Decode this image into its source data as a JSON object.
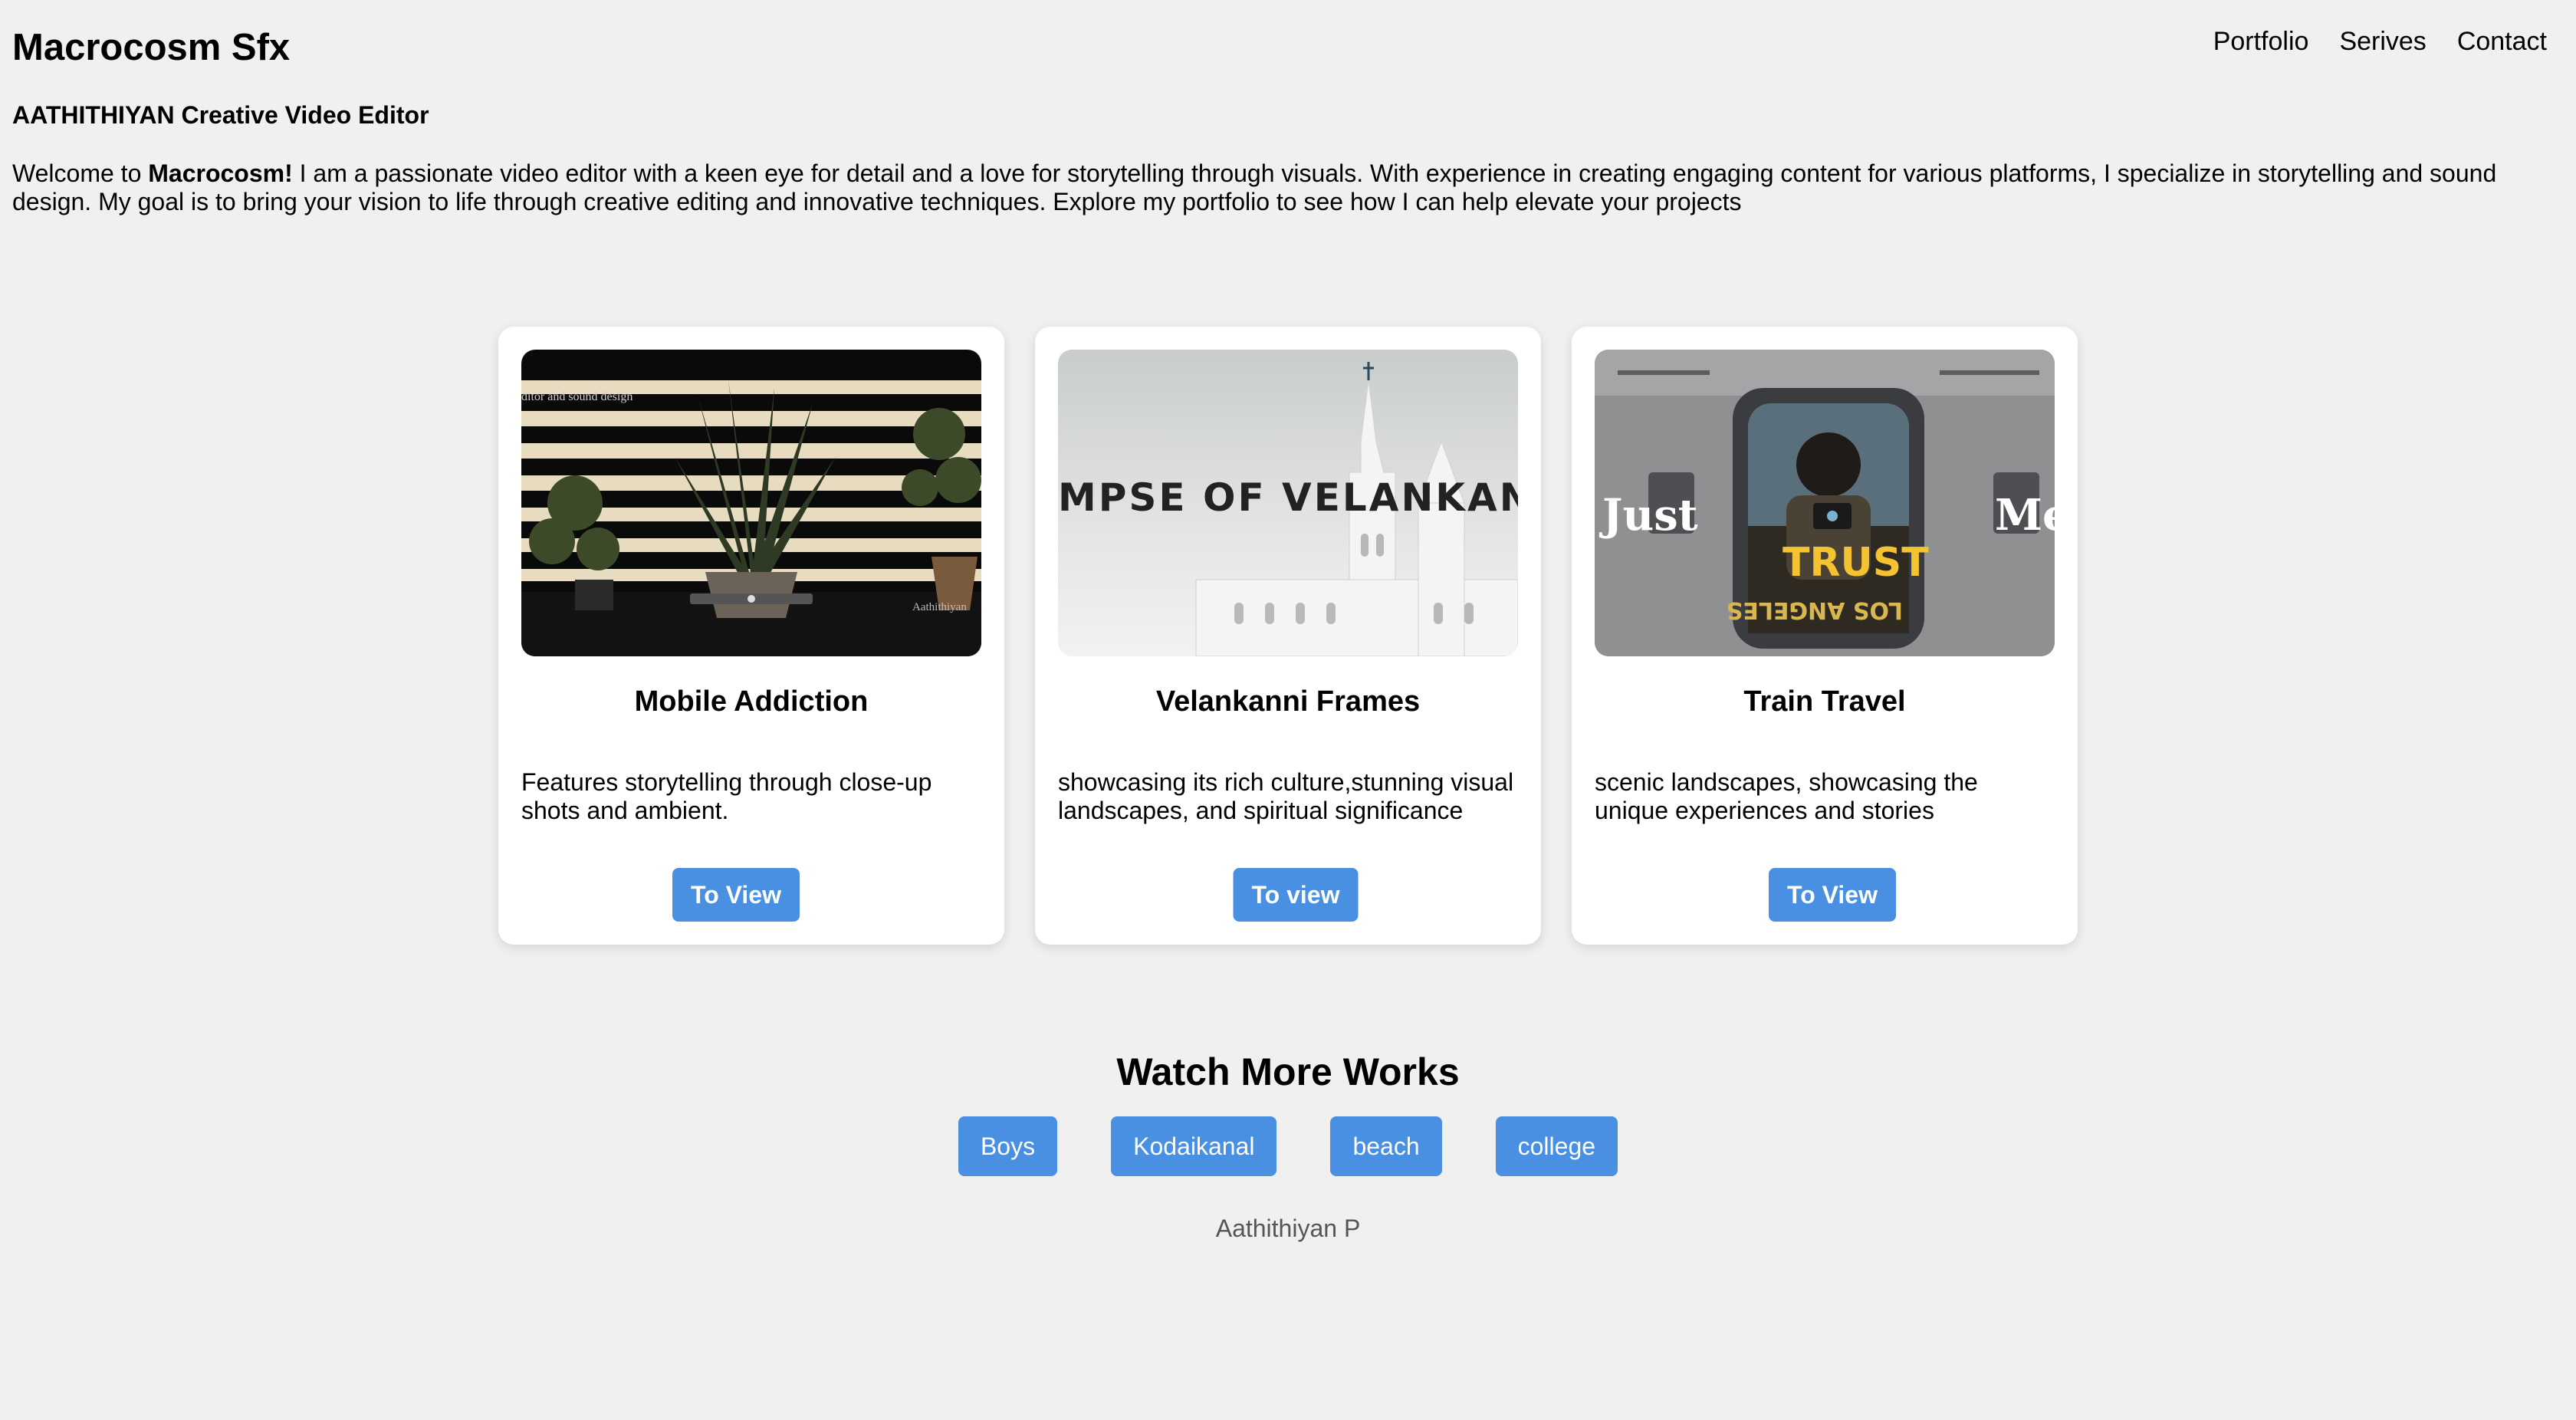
{
  "header": {
    "site_title": "Macrocosm Sfx",
    "nav": [
      "Portfolio",
      "Serives",
      "Contact"
    ]
  },
  "subtitle": "AATHITHIYAN Creative Video Editor",
  "intro": {
    "prefix": "Welcome to ",
    "brand": "Macrocosm!",
    "text": " I am a passionate video editor with a keen eye for detail and a love for storytelling through visuals. With experience in creating engaging content for various platforms, I specialize in storytelling and sound design. My goal is to bring your vision to life through creative editing and innovative techniques. Explore my portfolio to see how I can help elevate your projects"
  },
  "cards": [
    {
      "title": "Mobile Addiction",
      "description": "Features storytelling through close-up shots and ambient.",
      "button": "To View",
      "thumb_text": [
        "ditor and sound design",
        "Aathithiyan"
      ]
    },
    {
      "title": "Velankanni Frames",
      "description": "showcasing its rich culture,stunning visual landscapes, and spiritual significance",
      "button": "To view",
      "thumb_text": [
        "MPSE OF VELANKANNI"
      ]
    },
    {
      "title": "Train Travel",
      "description": "scenic landscapes, showcasing the unique experiences and stories",
      "button": "To View",
      "thumb_text": [
        "Just",
        "Me",
        "TRUST",
        "LOS ANGELES"
      ]
    }
  ],
  "more_works": {
    "title": "Watch More Works",
    "tags": [
      "Boys",
      "Kodaikanal",
      "beach",
      "college"
    ]
  },
  "footer": "Aathithiyan P",
  "colors": {
    "background": "#f0f0f0",
    "card": "#ffffff",
    "button": "#4a90e2",
    "button_text": "#ffffff",
    "footer_text": "#555555"
  }
}
